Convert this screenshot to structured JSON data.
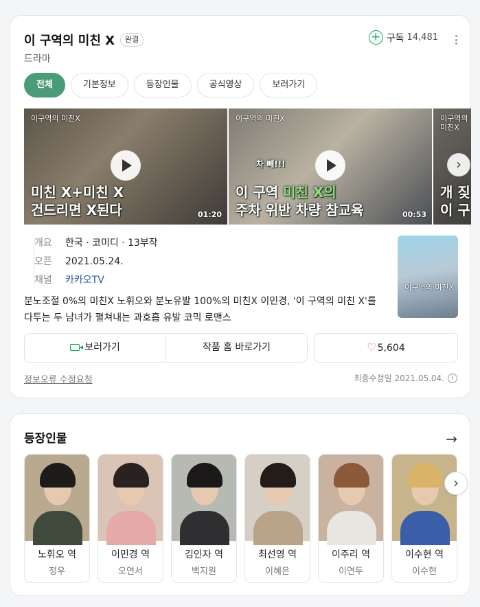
{
  "header": {
    "title": "이 구역의 미친 X",
    "badge": "완결",
    "genre": "드라마",
    "subscribe_label": "구독",
    "subscribe_count": "14,481"
  },
  "tabs": [
    {
      "label": "전체",
      "active": true
    },
    {
      "label": "기본정보",
      "active": false
    },
    {
      "label": "등장인물",
      "active": false
    },
    {
      "label": "공식영상",
      "active": false
    },
    {
      "label": "보러가기",
      "active": false
    }
  ],
  "videos": [
    {
      "logo": "이구역의 미친X",
      "line1": "미친 X+미친 X",
      "line2": "건드리면 X된다",
      "duration": "01:20"
    },
    {
      "logo": "이구역의 미친X",
      "sticker": "차 빼!!!",
      "line1_pre": "이 구역 ",
      "line1_hl": "미친 X의",
      "line2": "주차 위반 차량 참교육",
      "duration": "00:53"
    },
    {
      "logo": "이구역의 미친X",
      "line1": "개 짖",
      "line2": "이 구"
    }
  ],
  "info": {
    "rows": [
      {
        "key": "개요",
        "value": "한국 · 코미디 · 13부작"
      },
      {
        "key": "오픈",
        "value": "2021.05.24."
      },
      {
        "key": "채널",
        "value": "카카오TV"
      }
    ],
    "poster_text": "이구역의 미친X"
  },
  "description": "분노조절 0%의 미친X 노휘오와 분노유발 100%의 미친X 이민경, '이 구역의 미친 X'를 다투는 두 남녀가 펼쳐내는 과호흡 유발 코믹 로맨스",
  "actions": {
    "watch_label": "보러가기",
    "home_label": "작품 홈 바로가기",
    "like_count": "5,604"
  },
  "footer": {
    "report_label": "정보오류 수정요청",
    "updated": "최종수정일 2021.05.04."
  },
  "cast_section": {
    "title": "등장인물",
    "members": [
      {
        "role": "노휘오 역",
        "actor": "정우"
      },
      {
        "role": "이민경 역",
        "actor": "오연서"
      },
      {
        "role": "김인자 역",
        "actor": "백지원"
      },
      {
        "role": "최선영 역",
        "actor": "이혜은"
      },
      {
        "role": "이주리 역",
        "actor": "이연두"
      },
      {
        "role": "이수현 역",
        "actor": "이수현"
      }
    ]
  },
  "colors": {
    "accent_green": "#4a9b78",
    "brand_green": "#03a94d",
    "link_blue": "#2655a6",
    "heart_red": "#e84848"
  }
}
